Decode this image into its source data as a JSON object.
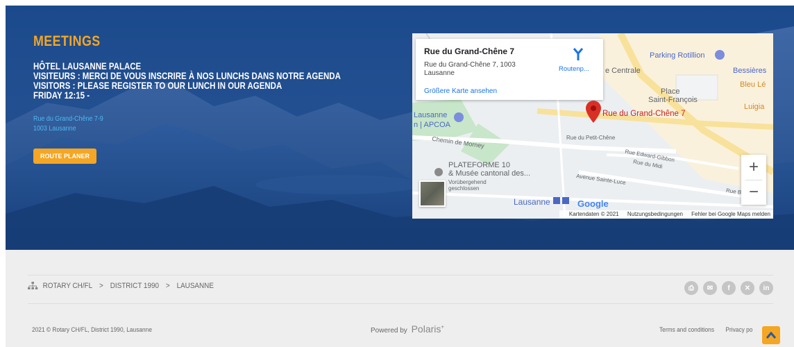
{
  "hero": {
    "title": "MEETINGS",
    "lines": [
      "HÔTEL LAUSANNE PALACE",
      "VISITEURS : MERCI DE VOUS INSCRIRE À NOS LUNCHS DANS NOTRE AGENDA",
      "VISITORS : PLEASE REGISTER TO OUR LUNCH IN OUR AGENDA",
      "FRIDAY 12:15 -"
    ],
    "address_line1": "Rue du Grand-Chêne 7-9",
    "address_line2": "1003 Lausanne",
    "route_button": "ROUTE PLANER",
    "accent_color": "#f5a623"
  },
  "map": {
    "card_title": "Rue du Grand-Chêne 7",
    "card_address": "Rue du Grand-Chêne 7, 1003 Lausanne",
    "card_link": "Größere Karte ansehen",
    "route_label": "Routenp...",
    "labels": {
      "parking": "Parking Rotillion",
      "centrale": "e Centrale",
      "bessieres": "Bessières",
      "bleu": "Bleu Lé",
      "place": "Place",
      "saint_francois": "Saint-François",
      "luigia": "Luigia",
      "pin_label": "Rue du Grand-Chêne 7",
      "lausanne_apcoa_1": "Lausanne",
      "lausanne_apcoa_2": "n | APCOA",
      "chemin": "Chemin de Morney",
      "petit_chene": "Rue du Petit-Chêne",
      "edward": "Rue Edward-Gibbon",
      "midi": "Rue du Midi",
      "sainte_luce": "Avenue Sainte-Luce",
      "bes": "Rue Bes",
      "plateforme_1": "PLATEFORME 10",
      "plateforme_2": "& Musée cantonal des...",
      "plateforme_3": "Vorübergehend",
      "plateforme_4": "geschlossen",
      "lausanne_station": "Lausanne",
      "google": "Google"
    },
    "zoom_in": "+",
    "zoom_out": "−",
    "footer_data": "Kartendaten © 2021",
    "footer_terms": "Nutzungsbedingungen",
    "footer_report": "Fehler bei Google Maps melden"
  },
  "footer": {
    "breadcrumb": [
      "ROTARY CH/FL",
      "DISTRICT 1990",
      "LAUSANNE"
    ],
    "breadcrumb_sep": ">",
    "social_icons": [
      "print-icon",
      "email-icon",
      "facebook-icon",
      "xing-icon",
      "linkedin-icon"
    ],
    "copyright": "2021 © Rotary CH/FL, District 1990, Lausanne",
    "powered_by": "Powered by",
    "polaris": "Polaris",
    "polaris_sup": "+",
    "terms": "Terms and conditions",
    "privacy": "Privacy po"
  }
}
